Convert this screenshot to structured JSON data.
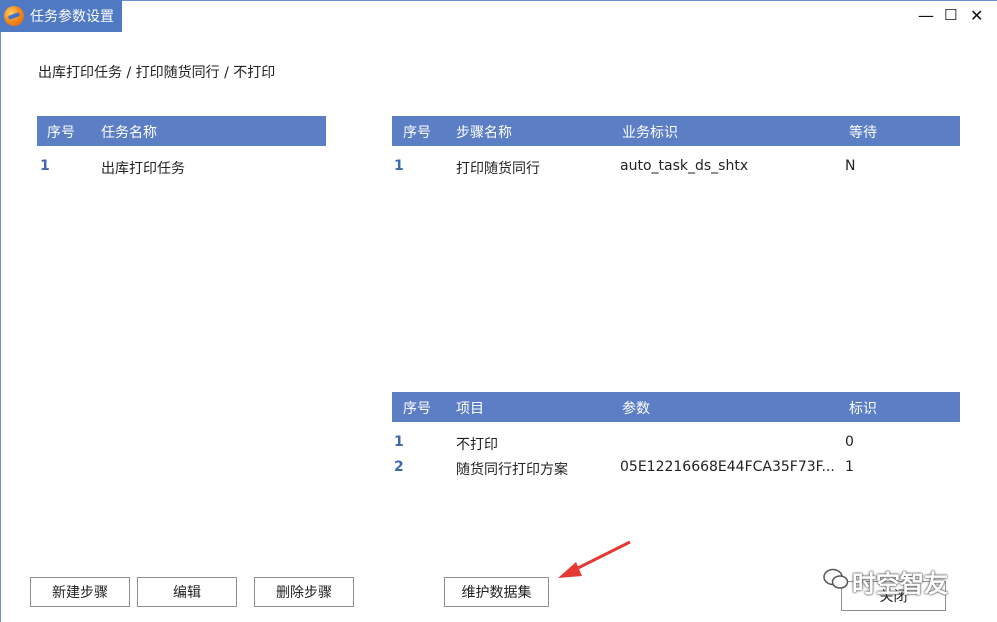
{
  "window": {
    "title": "任务参数设置",
    "minimize": "—",
    "maximize": "☐",
    "close": "✕"
  },
  "breadcrumb": "出库打印任务 / 打印随货同行 / 不打印",
  "tasks_table": {
    "headers": {
      "index": "序号",
      "name": "任务名称"
    },
    "rows": [
      {
        "index": "1",
        "name": "出库打印任务"
      }
    ]
  },
  "steps_table": {
    "headers": {
      "index": "序号",
      "name": "步骤名称",
      "id": "业务标识",
      "wait": "等待"
    },
    "rows": [
      {
        "index": "1",
        "name": "打印随货同行",
        "id": "auto_task_ds_shtx",
        "wait": "N"
      }
    ]
  },
  "params_table": {
    "headers": {
      "index": "序号",
      "item": "项目",
      "param": "参数",
      "flag": "标识"
    },
    "rows": [
      {
        "index": "1",
        "item": "不打印",
        "param": "",
        "flag": "0"
      },
      {
        "index": "2",
        "item": "随货同行打印方案",
        "param": "05E12216668E44FCA35F73F...",
        "flag": "1"
      }
    ]
  },
  "buttons": {
    "new_step": "新建步骤",
    "edit": "编辑",
    "delete_step": "删除步骤",
    "maintain_dataset": "维护数据集",
    "close": "关闭"
  },
  "watermark": "时空智友",
  "colors": {
    "titlebar": "#4f79c2",
    "header": "#5b7ec4",
    "index_text": "#3f68b2",
    "arrow": "#e53935"
  }
}
